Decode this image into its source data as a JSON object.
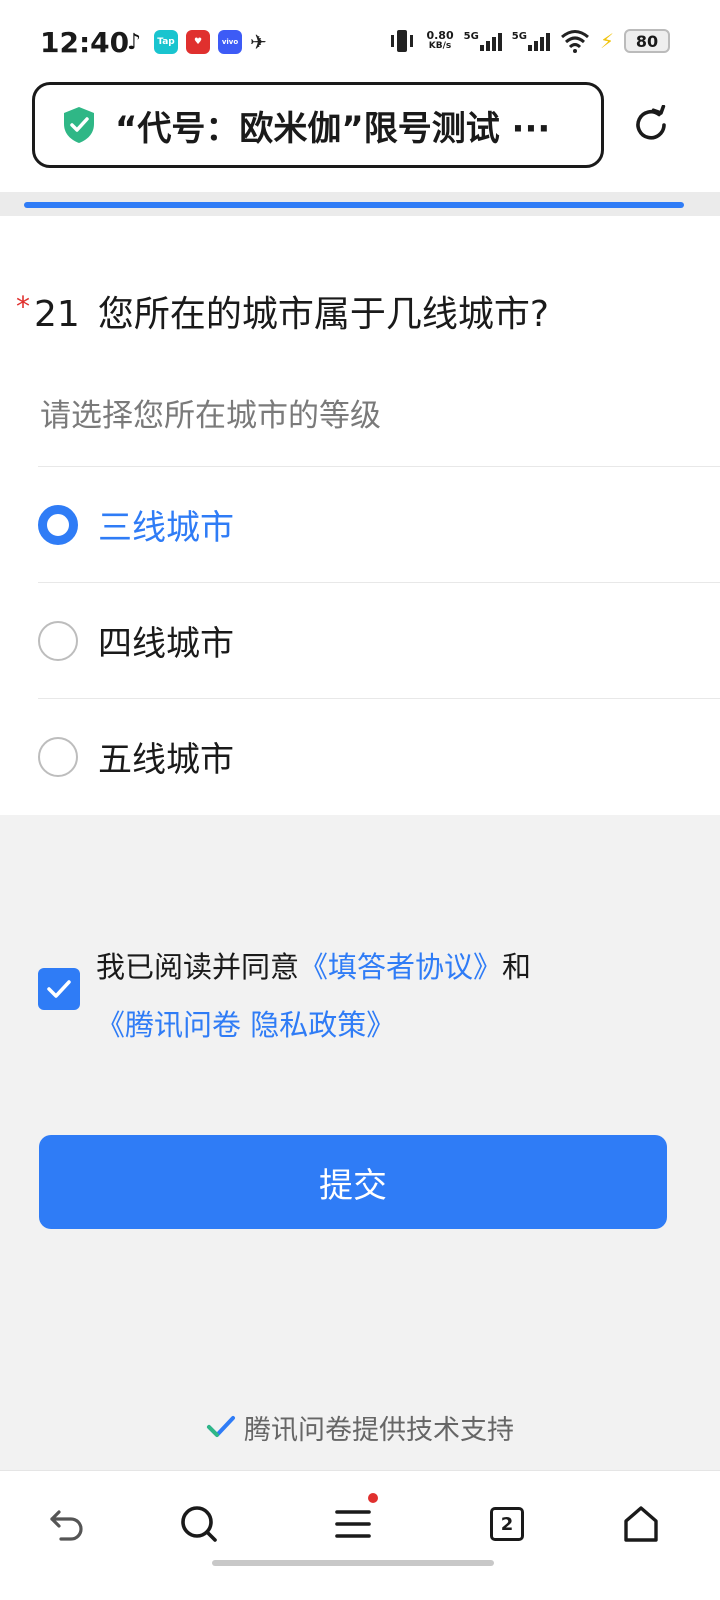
{
  "status_bar": {
    "time": "12:40",
    "apps": [
      {
        "icon": "tiktok-icon",
        "label": "",
        "color": "#111111"
      },
      {
        "icon": "taptap-icon",
        "label": "Tap",
        "color": "#19c4cf"
      },
      {
        "icon": "app-red-icon",
        "label": "",
        "color": "#e0302e"
      },
      {
        "icon": "vivo-icon",
        "label": "vivo",
        "color": "#3d5bf6"
      }
    ],
    "net_speed_value": "0.80",
    "net_speed_unit": "KB/s",
    "sim1_label": "5G",
    "sim2_label": "5G",
    "battery": "80"
  },
  "browser": {
    "page_title": "“代号：欧米伽”限号测试 ···",
    "progress_percent": 100
  },
  "question": {
    "required_mark": "*",
    "number": "21",
    "text": "您所在的城市属于几线城市?",
    "hint": "请选择您所在城市的等级",
    "options": [
      {
        "label": "三线城市",
        "selected": true
      },
      {
        "label": "四线城市",
        "selected": false
      },
      {
        "label": "五线城市",
        "selected": false
      }
    ]
  },
  "agreement": {
    "checked": true,
    "prefix": "我已阅读并同意",
    "link1": "《填答者协议》",
    "conjunction": "和",
    "link2": "《腾讯问卷 隐私政策》"
  },
  "submit_label": "提交",
  "footer_text": "腾讯问卷提供技术支持",
  "bottom_nav": {
    "tabs_count": "2"
  },
  "colors": {
    "accent": "#2f7cf6",
    "required": "#e0302e"
  }
}
